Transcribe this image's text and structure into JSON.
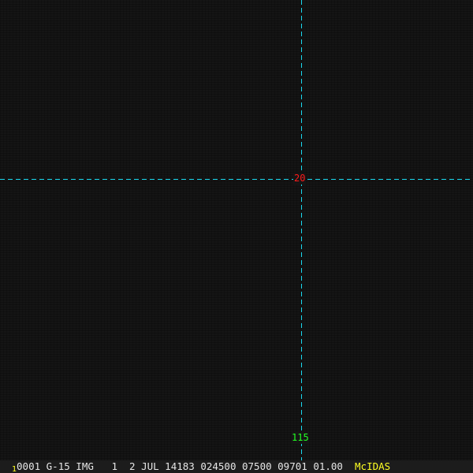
{
  "grid": {
    "latitude_label": "20",
    "longitude_label": "115",
    "line_color": "#19d9f0"
  },
  "status_bar": {
    "frame_number": "1",
    "fields": "0001 G-15 IMG   1  2 JUL 14183 024500 07500 09701 01.00",
    "brand": "McIDAS"
  }
}
